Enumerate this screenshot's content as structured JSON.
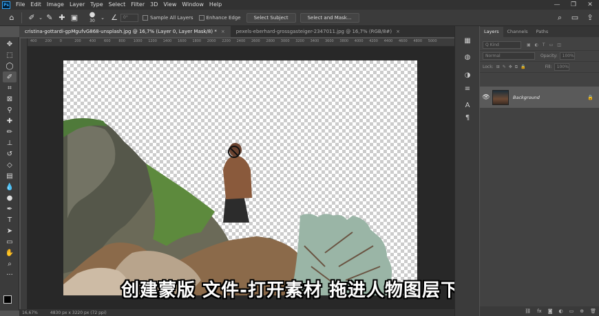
{
  "app_icon": "Ps",
  "menu": [
    "File",
    "Edit",
    "Image",
    "Layer",
    "Type",
    "Select",
    "Filter",
    "3D",
    "View",
    "Window",
    "Help"
  ],
  "window_controls": [
    "—",
    "❐",
    "✕"
  ],
  "options": {
    "brush_size": "30",
    "angle": "0°",
    "sample_all_layers": "Sample All Layers",
    "enhance_edge": "Enhance Edge",
    "select_subject": "Select Subject",
    "select_and_mask": "Select and Mask..."
  },
  "tabs": [
    {
      "label": "cristina-gottardi-gpMgufvG868-unsplash.jpg @ 16,7% (Layer 0, Layer Mask/8) *",
      "close": "×"
    },
    {
      "label": "pexels-eberhard-grossgasteiger-2347011.jpg @ 16,7% (RGB/8#)",
      "close": "×"
    }
  ],
  "ruler_ticks": [
    "400",
    "200",
    "0",
    "200",
    "400",
    "600",
    "800",
    "1000",
    "1200",
    "1400",
    "1600",
    "1800",
    "2000",
    "2200",
    "2400",
    "2600",
    "2800",
    "3000",
    "3200",
    "3400",
    "3600",
    "3800",
    "4000",
    "4200",
    "4400",
    "4600",
    "4800",
    "5000"
  ],
  "status": {
    "zoom": "16,67%",
    "doc_size": "4830 px x 3220 px (72 ppi)"
  },
  "subtitle": "创建蒙版 文件-打开素材 拖进人物图层下方",
  "layers_panel": {
    "tabs": [
      "Layers",
      "Channels",
      "Paths"
    ],
    "kind": "Q Kind",
    "blend_mode": "Normal",
    "opacity_label": "Opacity:",
    "opacity": "100%",
    "lock_label": "Lock:",
    "fill_label": "Fill:",
    "fill": "100%",
    "layer_name": "Background"
  },
  "colors": {
    "accent": "#31a8ff",
    "panel": "#424242",
    "selected_layer": "#5a5a5a"
  }
}
